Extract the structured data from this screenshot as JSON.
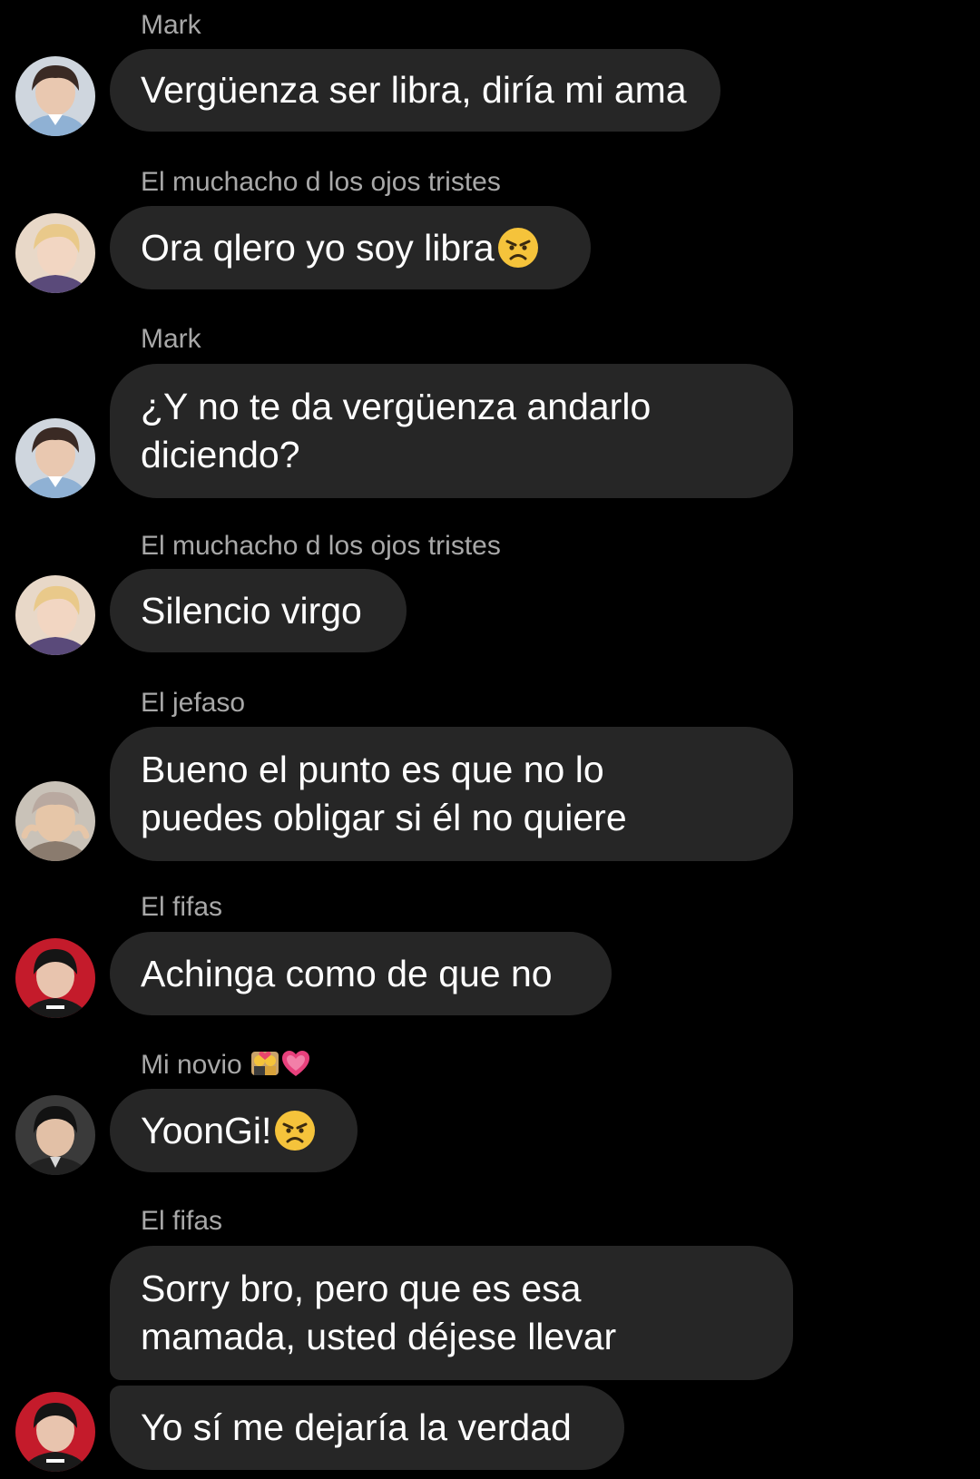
{
  "messages": [
    {
      "sender": "Mark",
      "text": "Vergüenza ser libra, diría mi ama"
    },
    {
      "sender": "El muchacho d los ojos tristes",
      "text": "Ora qlero yo soy libra",
      "emoji": "angry-face"
    },
    {
      "sender": "Mark",
      "text": "¿Y no te da vergüenza andarlo\ndiciendo?"
    },
    {
      "sender": "El muchacho d los ojos tristes",
      "text": "Silencio virgo"
    },
    {
      "sender": "El jefaso",
      "text": "Bueno el punto es que no lo\npuedes obligar si él no quiere"
    },
    {
      "sender": "El fifas",
      "text": "Achinga como de que no"
    },
    {
      "sender": "Mi novio",
      "sender_emojis": [
        "kiss-couple",
        "growing-heart"
      ],
      "text": "YoonGi!",
      "emoji": "angry-face"
    },
    {
      "sender": "El fifas",
      "text": "Sorry bro, pero que es esa\nmamada, usted déjese llevar"
    },
    {
      "sender": "",
      "text": "Yo sí me dejaría la verdad"
    }
  ],
  "colors": {
    "background": "#000000",
    "bubble": "#262626",
    "sender_text": "#a8a8a8",
    "message_text": "#ffffff"
  }
}
